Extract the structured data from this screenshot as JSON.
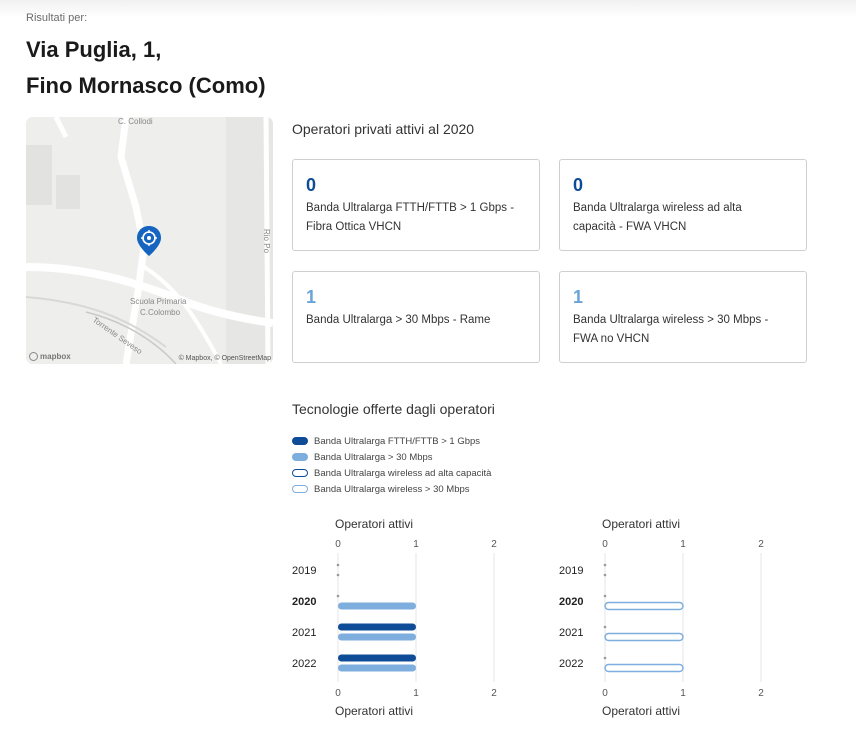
{
  "header": {
    "results_for": "Risultati per:",
    "address_line1": "Via Puglia, 1,",
    "address_line2": "Fino Mornasco (Como)"
  },
  "map": {
    "labels": {
      "street_top": "C. Collodi",
      "school_1": "Scuola Primaria",
      "school_2": "C.Colombo",
      "stream": "Torrente Seveso",
      "road_right": "Rio Po"
    },
    "attribution": "© Mapbox, © OpenStreetMap",
    "logo": "mapbox",
    "pin_color": "#1565c0"
  },
  "operators": {
    "title": "Operatori privati attivi al 2020",
    "cards": [
      {
        "value": "0",
        "label_line1": "Banda Ultralarga FTTH/FTTB > 1 Gbps -",
        "label_line2": "Fibra Ottica VHCN"
      },
      {
        "value": "0",
        "label_line1": "Banda Ultralarga wireless ad alta",
        "label_line2": "capacità - FWA VHCN"
      },
      {
        "value": "1",
        "label_line1": "Banda Ultralarga > 30 Mbps - Rame",
        "label_line2": ""
      },
      {
        "value": "1",
        "label_line1": "Banda Ultralarga wireless > 30 Mbps -",
        "label_line2": "FWA no VHCN"
      }
    ]
  },
  "technologies": {
    "title": "Tecnologie offerte dagli operatori",
    "legend": [
      {
        "label": "Banda Ultralarga FTTH/FTTB > 1 Gbps",
        "style": "filled",
        "color": "#0f4c97"
      },
      {
        "label": "Banda Ultralarga > 30 Mbps",
        "style": "filled",
        "color": "#7eaedd"
      },
      {
        "label": "Banda Ultralarga wireless ad alta capacità",
        "style": "outline",
        "color": "#0f4c97"
      },
      {
        "label": "Banda Ultralarga wireless > 30 Mbps",
        "style": "outline",
        "color": "#7eaedd"
      }
    ]
  },
  "chart_data": [
    {
      "type": "bar",
      "orientation": "horizontal",
      "xlabel": "Operatori attivi",
      "xlim": [
        0,
        2
      ],
      "xticks": [
        "0",
        "1",
        "2"
      ],
      "categories": [
        "2019",
        "2020",
        "2021",
        "2022"
      ],
      "highlight_category": "2020",
      "series": [
        {
          "name": "Banda Ultralarga FTTH/FTTB > 1 Gbps",
          "values": [
            0,
            0,
            1,
            1
          ],
          "color": "#0f4c97",
          "style": "filled"
        },
        {
          "name": "Banda Ultralarga > 30 Mbps",
          "values": [
            0,
            1,
            1,
            1
          ],
          "color": "#7eaedd",
          "style": "filled"
        }
      ]
    },
    {
      "type": "bar",
      "orientation": "horizontal",
      "xlabel": "Operatori attivi",
      "xlim": [
        0,
        2
      ],
      "xticks": [
        "0",
        "1",
        "2"
      ],
      "categories": [
        "2019",
        "2020",
        "2021",
        "2022"
      ],
      "highlight_category": "2020",
      "series": [
        {
          "name": "Banda Ultralarga wireless ad alta capacità",
          "values": [
            0,
            0,
            0,
            0
          ],
          "color": "#0f4c97",
          "style": "outline"
        },
        {
          "name": "Banda Ultralarga wireless > 30 Mbps",
          "values": [
            0,
            1,
            1,
            1
          ],
          "color": "#7eaedd",
          "style": "outline"
        }
      ]
    }
  ]
}
